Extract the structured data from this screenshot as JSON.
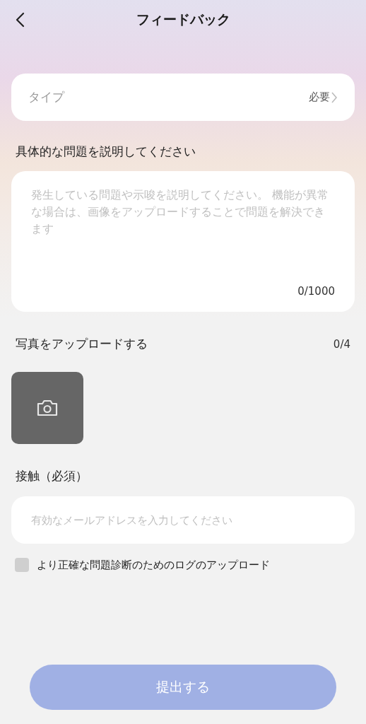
{
  "header": {
    "title": "フィードバック"
  },
  "type_field": {
    "label": "タイプ",
    "value": "必要"
  },
  "description": {
    "label": "具体的な問題を説明してください",
    "placeholder": "発生している問題や示唆を説明してください。 機能が異常な場合は、画像をアップロードすることで問題を解決できます",
    "counter": "0/1000"
  },
  "photos": {
    "label": "写真をアップロードする",
    "counter": "0/4"
  },
  "contact": {
    "label": "接触（必須）",
    "placeholder": "有効なメールアドレスを入力してください"
  },
  "log_upload": {
    "label": "より正確な問題診断のためのログのアップロード",
    "checked": false
  },
  "submit": {
    "label": "提出する",
    "disabled": true
  }
}
